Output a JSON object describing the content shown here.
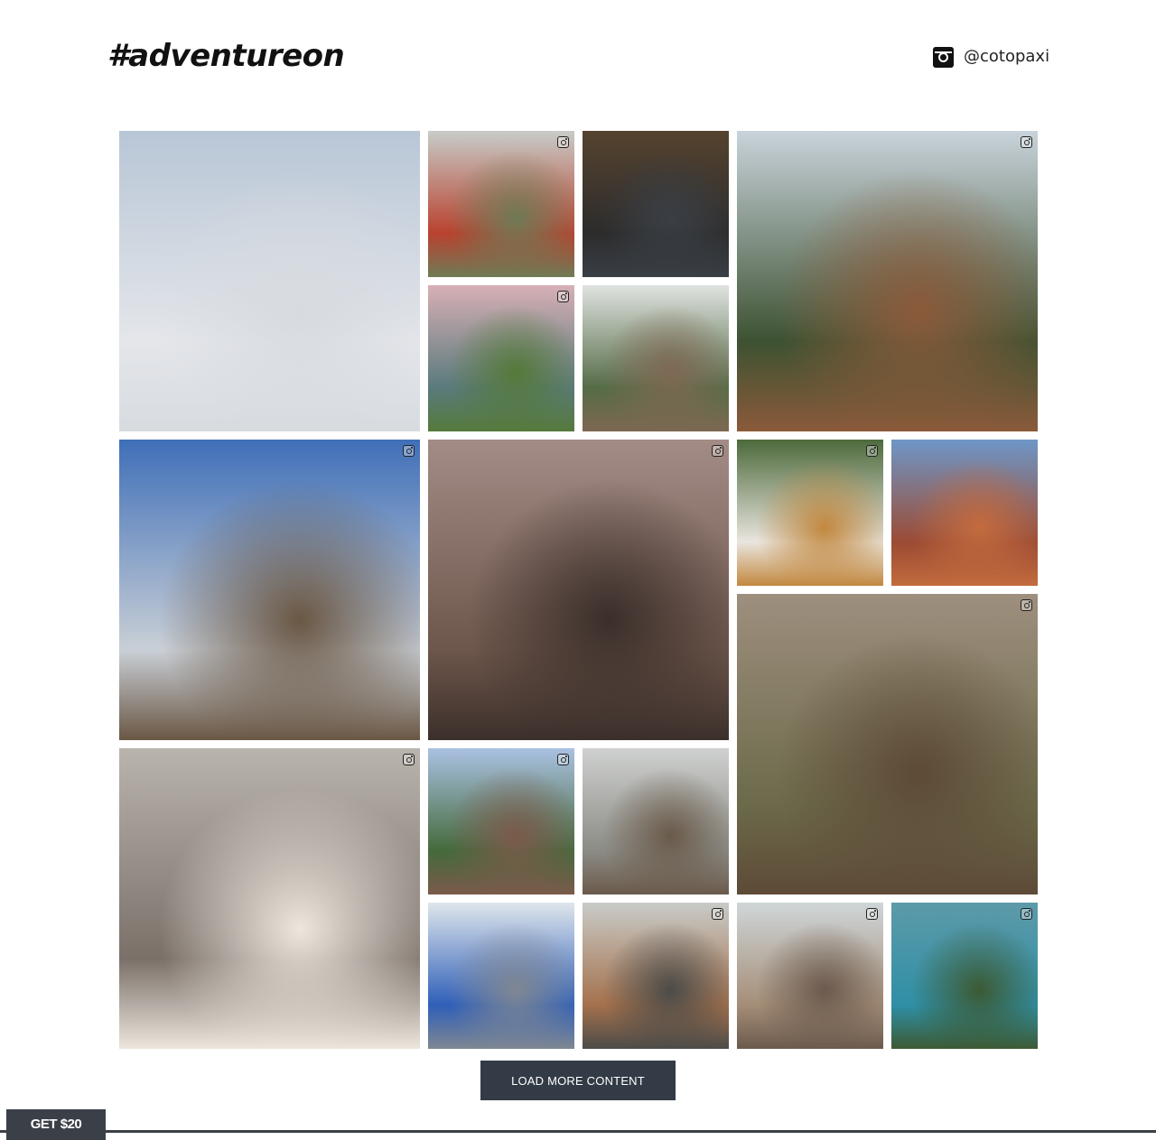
{
  "header": {
    "hashtag": "#adventureon",
    "instagram_handle": "@cotopaxi",
    "instagram_icon": "instagram-icon"
  },
  "gallery": {
    "tile_badge_icon": "instagram-icon",
    "tiles": [
      {
        "name": "photo-skateboard-salt-flats",
        "colors": [
          "#b8c6d6",
          "#e4e6ea",
          "#d7dbe0"
        ]
      },
      {
        "name": "photo-red-tuk-tuk",
        "colors": [
          "#c7ccc8",
          "#b9422f",
          "#6f7a55"
        ]
      },
      {
        "name": "photo-climbing-gym",
        "colors": [
          "#56432f",
          "#2c2c2c",
          "#3a3f46"
        ]
      },
      {
        "name": "photo-forest-overlook",
        "colors": [
          "#c9d3db",
          "#3d5232",
          "#8b5a3a"
        ]
      },
      {
        "name": "photo-alpine-lake",
        "colors": [
          "#d7b0b6",
          "#5a7a7c",
          "#557a3a"
        ]
      },
      {
        "name": "photo-trail-backpackers",
        "colors": [
          "#dfe3e0",
          "#566c47",
          "#7e6853"
        ]
      },
      {
        "name": "photo-snowy-peaks",
        "colors": [
          "#3f6fb8",
          "#c9cfd6",
          "#6a5744"
        ]
      },
      {
        "name": "photo-canyon-ponytail",
        "colors": [
          "#a38c86",
          "#6d564b",
          "#3b2f2a"
        ]
      },
      {
        "name": "photo-bike-dog",
        "colors": [
          "#4d6a3c",
          "#e9e5de",
          "#c2883f"
        ]
      },
      {
        "name": "photo-red-desert-dog",
        "colors": [
          "#6e97c8",
          "#9b4b34",
          "#c36b3e"
        ]
      },
      {
        "name": "photo-jumping-jacket",
        "colors": [
          "#9e8f7e",
          "#6c6a4a",
          "#5d4a37"
        ]
      },
      {
        "name": "photo-curly-hair-backpack",
        "colors": [
          "#b9b4ad",
          "#7a7069",
          "#ece6dd"
        ]
      },
      {
        "name": "photo-river-overlook",
        "colors": [
          "#aac1e2",
          "#456a3c",
          "#7b5a4b"
        ]
      },
      {
        "name": "photo-misty-cliff",
        "colors": [
          "#cfd1d0",
          "#8c8c86",
          "#6a5a4a"
        ]
      },
      {
        "name": "photo-stretching-blue-shorts",
        "colors": [
          "#dfe6ec",
          "#2f5fb8",
          "#7f8792"
        ]
      },
      {
        "name": "photo-canyon-backpack",
        "colors": [
          "#c8cbc8",
          "#a5714c",
          "#4b4b48"
        ]
      },
      {
        "name": "photo-rock-scramble",
        "colors": [
          "#cfd6d8",
          "#a58e78",
          "#6b5a4d"
        ]
      },
      {
        "name": "photo-tree-swing-water",
        "colors": [
          "#5d9aa9",
          "#2f8fa6",
          "#3c5a33"
        ]
      }
    ]
  },
  "actions": {
    "load_more_label": "LOAD MORE CONTENT",
    "promo_label": "GET $20"
  }
}
